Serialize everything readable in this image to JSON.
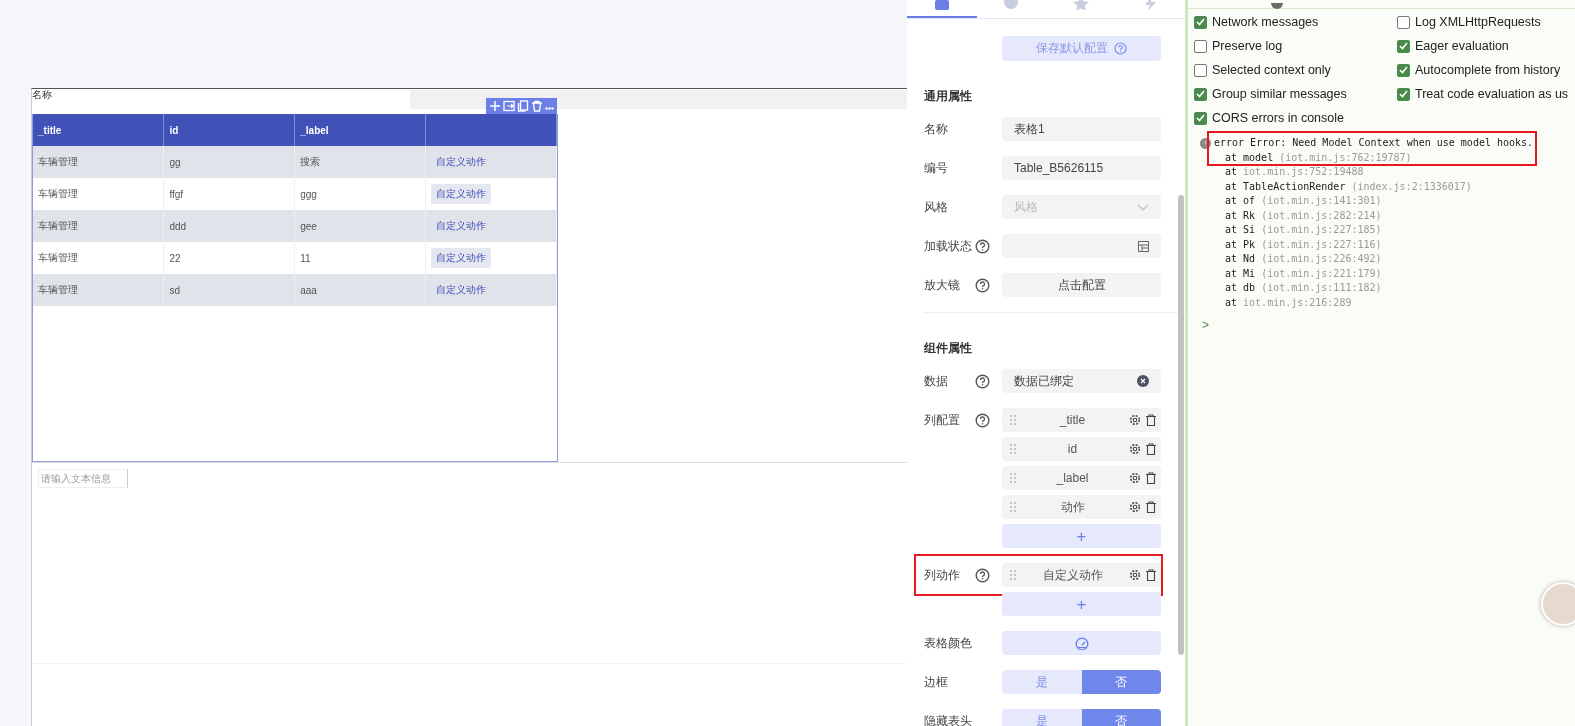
{
  "canvas": {
    "header_label": "名称",
    "table": {
      "columns": [
        "_title",
        "id",
        "_label",
        ""
      ],
      "rows": [
        [
          "车辆管理",
          "gg",
          "搜索",
          "自定义动作"
        ],
        [
          "车辆管理",
          "ffgf",
          "ggg",
          "自定义动作"
        ],
        [
          "车辆管理",
          "ddd",
          "gee",
          "自定义动作"
        ],
        [
          "车辆管理",
          "22",
          "11",
          "自定义动作"
        ],
        [
          "车辆管理",
          "sd",
          "aaa",
          "自定义动作"
        ]
      ]
    },
    "text_input": {
      "placeholder": "请输入文本信息"
    }
  },
  "panel": {
    "tabs": [
      {
        "selected": true
      },
      {
        "selected": false
      },
      {
        "selected": false
      },
      {
        "selected": false
      }
    ],
    "save_button": "保存默认配置",
    "general": {
      "title": "通用属性",
      "name_label": "名称",
      "name_value": "表格1",
      "id_label": "编号",
      "id_value": "Table_B5626115",
      "style_label": "风格",
      "style_placeholder": "风格",
      "loading_label": "加载状态",
      "magnifier_label": "放大镜",
      "magnifier_button": "点击配置"
    },
    "component": {
      "title": "组件属性",
      "data_label": "数据",
      "data_value": "数据已绑定",
      "columns_label": "列配置",
      "columns": [
        "_title",
        "id",
        "_label",
        "动作"
      ],
      "add": "+",
      "actions_label": "列动作",
      "actions": [
        "自定义动作"
      ],
      "color_label": "表格颜色",
      "toggles": [
        {
          "label": "边框",
          "options": [
            {
              "label": "是",
              "selected": false
            },
            {
              "label": "否",
              "selected": true
            }
          ]
        },
        {
          "label": "隐藏表头",
          "options": [
            {
              "label": "是",
              "selected": false
            },
            {
              "label": "否",
              "selected": true
            }
          ]
        }
      ]
    }
  },
  "console": {
    "settings": [
      {
        "label": "Network messages",
        "checked": true
      },
      {
        "label": "Log XMLHttpRequests",
        "checked": false
      },
      {
        "label": "Preserve log",
        "checked": false
      },
      {
        "label": "Eager evaluation",
        "checked": true
      },
      {
        "label": "Selected context only",
        "checked": false
      },
      {
        "label": "Autocomplete from history",
        "checked": true
      },
      {
        "label": "Group similar messages",
        "checked": true
      },
      {
        "label": "Treat code evaluation as us",
        "checked": true
      },
      {
        "label": "CORS errors in console",
        "checked": true
      }
    ],
    "error": {
      "message": "error Error: Need Model Context when use model hooks.",
      "frames": [
        {
          "fn": "at model",
          "loc": "(iot.min.js:762:19787)"
        },
        {
          "fn": "at",
          "loc": "iot.min.js:752:19488"
        },
        {
          "fn": "at TableActionRender",
          "loc": "(index.js:2:1336017)"
        },
        {
          "fn": "at of",
          "loc": "(iot.min.js:141:301)"
        },
        {
          "fn": "at Rk",
          "loc": "(iot.min.js:282:214)"
        },
        {
          "fn": "at Si",
          "loc": "(iot.min.js:227:185)"
        },
        {
          "fn": "at Pk",
          "loc": "(iot.min.js:227:116)"
        },
        {
          "fn": "at Nd",
          "loc": "(iot.min.js:226:492)"
        },
        {
          "fn": "at Mi",
          "loc": "(iot.min.js:221:179)"
        },
        {
          "fn": "at db",
          "loc": "(iot.min.js:111:182)"
        },
        {
          "fn": "at",
          "loc": "iot.min.js:216:289"
        }
      ]
    },
    "prompt": ">"
  }
}
